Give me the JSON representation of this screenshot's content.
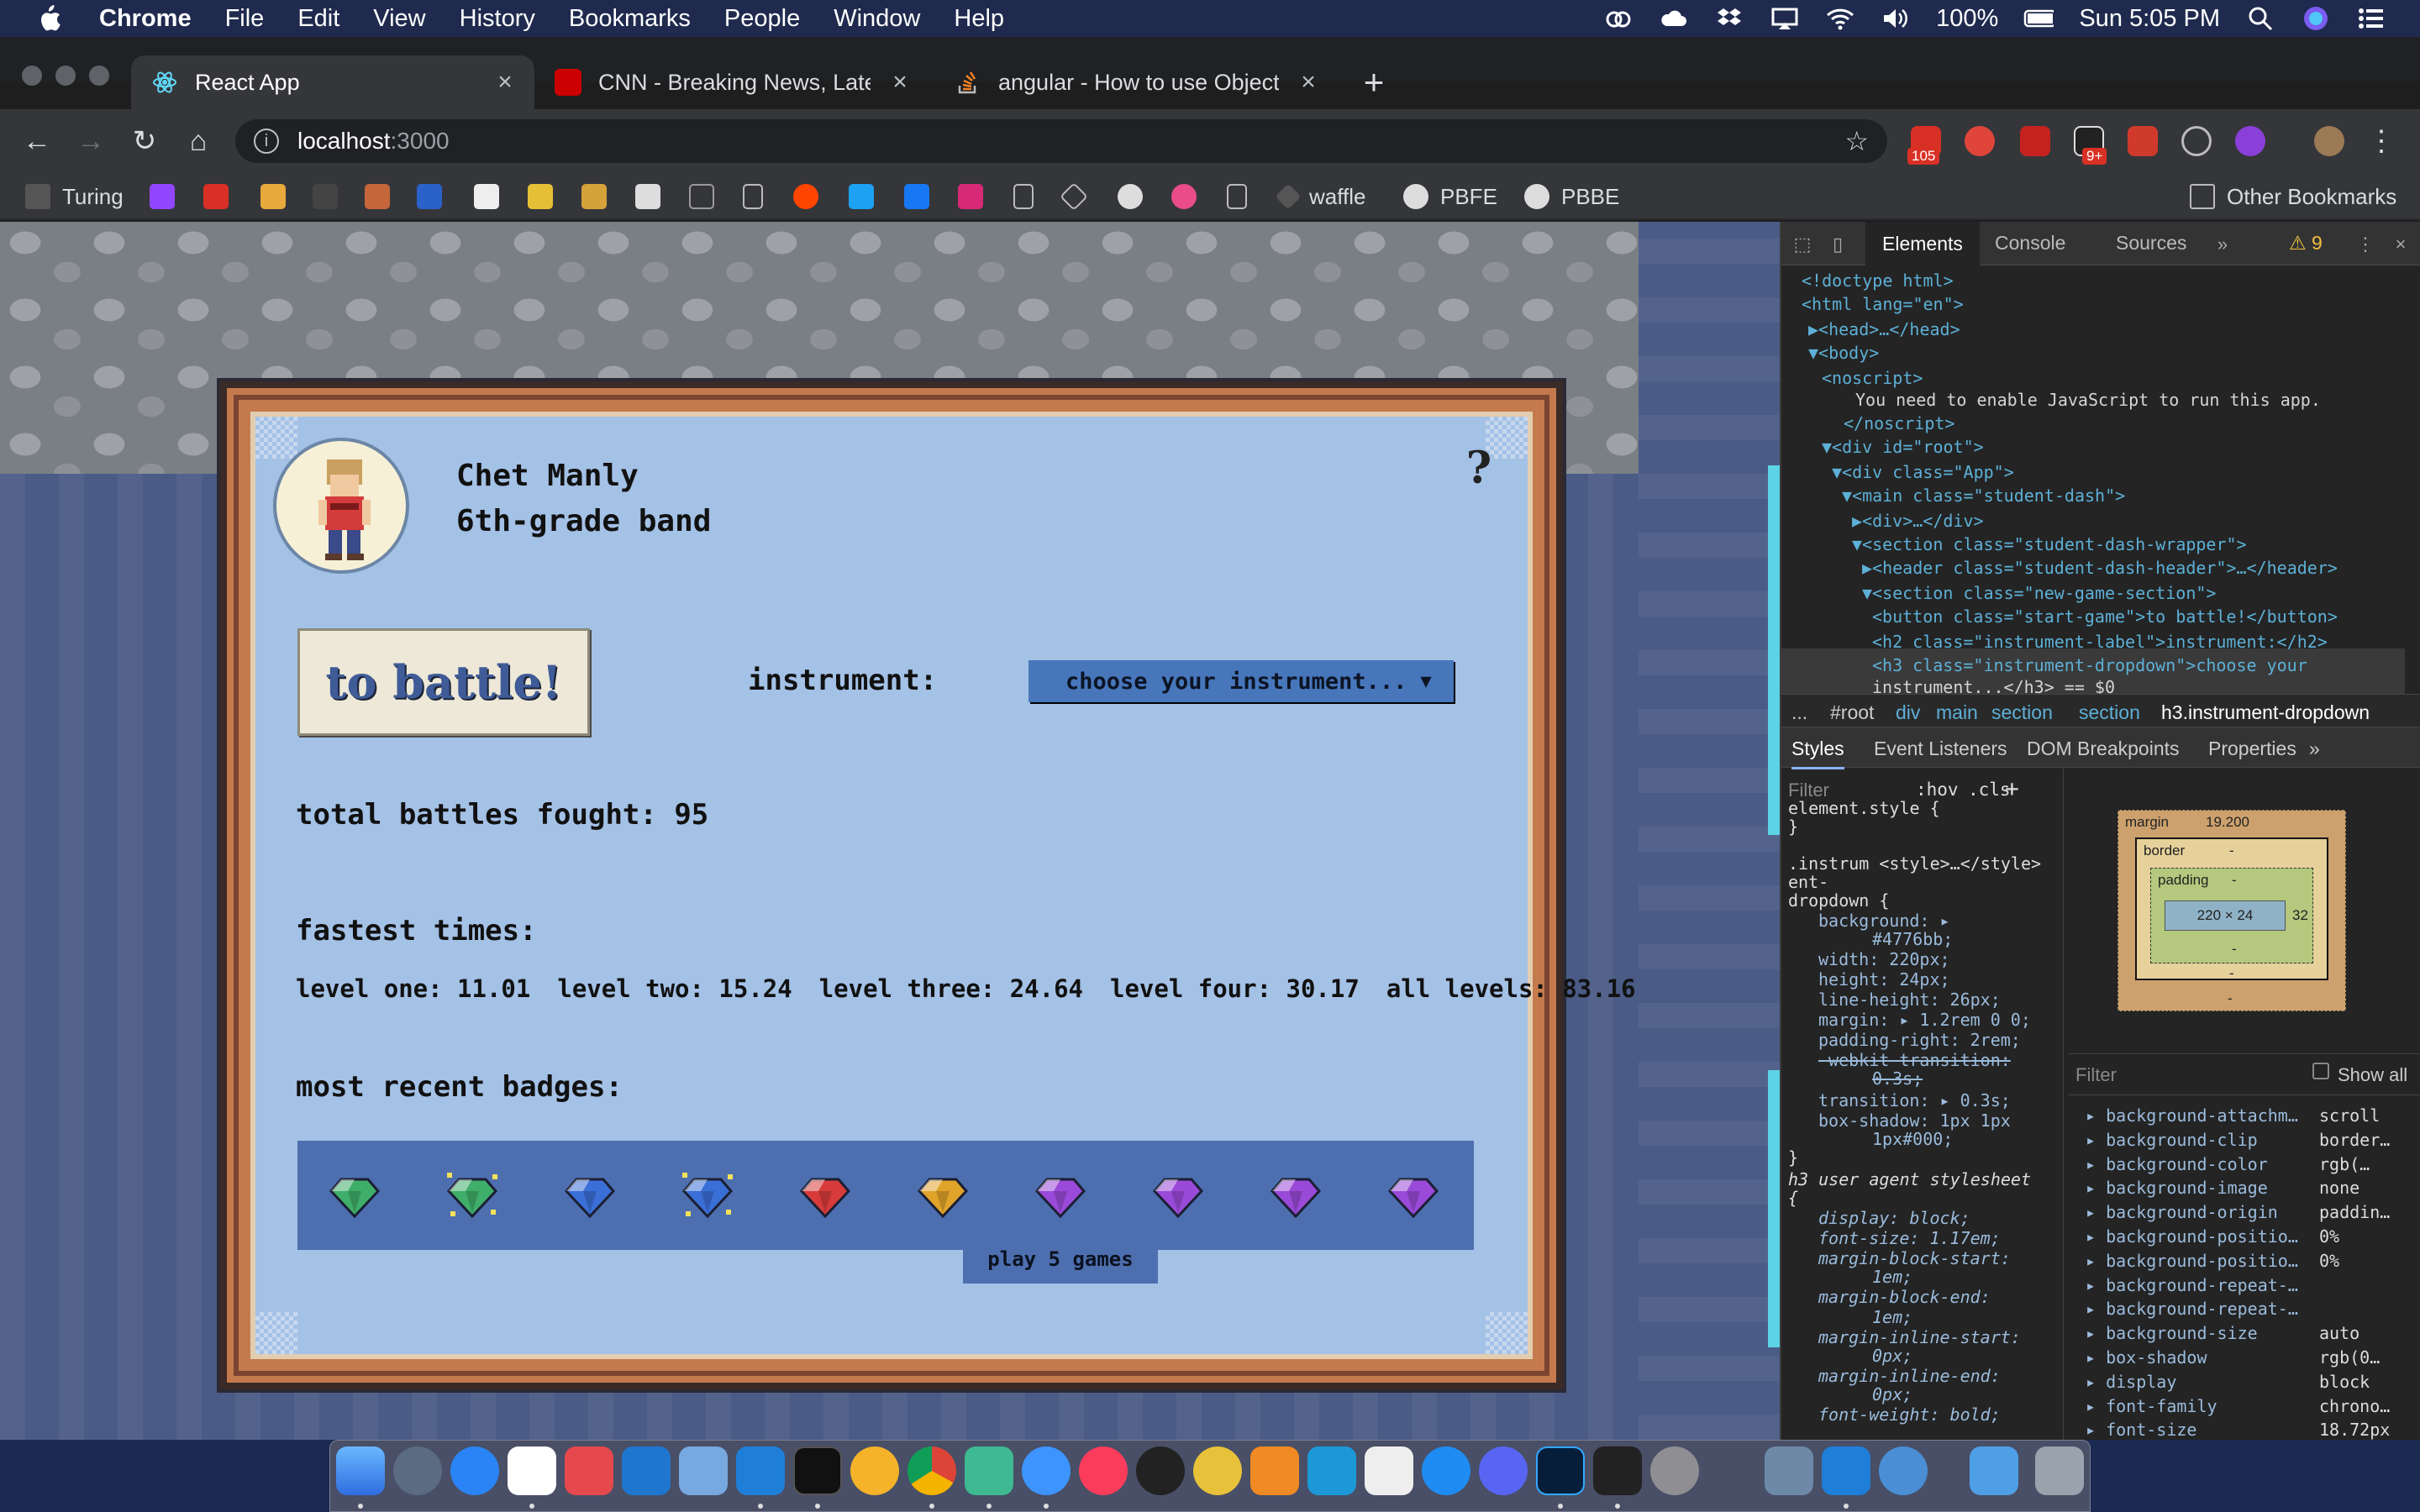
{
  "menubar": {
    "app": "Chrome",
    "items": [
      "File",
      "Edit",
      "View",
      "History",
      "Bookmarks",
      "People",
      "Window",
      "Help"
    ],
    "battery": "100%",
    "clock": "Sun 5:05 PM"
  },
  "browser": {
    "tabs": [
      {
        "title": "React App"
      },
      {
        "title": "CNN - Breaking News, Latest N"
      },
      {
        "title": "angular - How to use Object.va"
      }
    ],
    "url_host": "localhost",
    "url_port": ":3000",
    "ext_badges": [
      "105",
      "9+"
    ],
    "bookmarks": [
      "Turing",
      "waffle",
      "PBFE",
      "PBBE"
    ],
    "other_bookmarks": "Other Bookmarks"
  },
  "game": {
    "student_name": "Chet Manly",
    "student_class": "6th-grade band",
    "help_glyph": "?",
    "start_button": "to battle!",
    "instrument_label": "instrument:",
    "instrument_dropdown": "choose your instrument...",
    "total_battles": "total battles fought: 95",
    "fastest_heading": "fastest times:",
    "times": [
      "level one: 11.01",
      "level two: 15.24",
      "level three: 24.64",
      "level four: 30.17",
      "all levels: 83.16"
    ],
    "badges_heading": "most recent badges:",
    "badges": [
      {
        "color": "#3fae6a",
        "sparkle": false
      },
      {
        "color": "#3fae6a",
        "sparkle": true
      },
      {
        "color": "#3b6fd8",
        "sparkle": false
      },
      {
        "color": "#3b6fd8",
        "sparkle": true
      },
      {
        "color": "#d83b3b",
        "sparkle": false
      },
      {
        "color": "#e0a42a",
        "sparkle": false
      },
      {
        "color": "#9a4ad8",
        "sparkle": false
      },
      {
        "color": "#9a4ad8",
        "sparkle": false
      },
      {
        "color": "#9a4ad8",
        "sparkle": false
      },
      {
        "color": "#9a4ad8",
        "sparkle": false
      }
    ],
    "badge_tooltip": "play 5 games"
  },
  "devtools": {
    "tabs": [
      "Elements",
      "Console",
      "Sources"
    ],
    "warnings": "⚠ 9",
    "dom_lines": [
      "<!doctype html>",
      "<html lang=\"en\">",
      "▶<head>…</head>",
      "▼<body>",
      "<noscript>",
      "You need to enable JavaScript to run this app.",
      "</noscript>",
      "▼<div id=\"root\">",
      "▼<div class=\"App\">",
      "▼<main class=\"student-dash\">",
      "▶<div>…</div>",
      "▼<section class=\"student-dash-wrapper\">",
      "▶<header class=\"student-dash-header\">…</header>",
      "▼<section class=\"new-game-section\">",
      "<button class=\"start-game\">to battle!</button>",
      "<h2 class=\"instrument-label\">instrument:</h2>",
      "<h3 class=\"instrument-dropdown\">choose your",
      "instrument...</h3> == $0"
    ],
    "breadcrumbs": [
      "...",
      "#root",
      "div",
      "main",
      "section",
      "section",
      "h3.instrument-dropdown"
    ],
    "subtabs": [
      "Styles",
      "Event Listeners",
      "DOM Breakpoints",
      "Properties"
    ],
    "filter_placeholder": "Filter",
    "hov": ":hov",
    "cls": ".cls",
    "style_lines": [
      "element.style {",
      "}",
      ".instrum <style>…</style>",
      "ent-",
      "dropdown {",
      "background: ▸",
      "#4776bb;",
      "width: 220px;",
      "height: 24px;",
      "line-height: 26px;",
      "margin: ▸ 1.2rem 0 0;",
      "padding-right: 2rem;",
      "-webkit-transition:",
      "0.3s;",
      "transition: ▸ 0.3s;",
      "box-shadow: 1px 1px",
      "1px#000;",
      "}",
      "h3  user agent stylesheet",
      "{",
      "display: block;",
      "font-size: 1.17em;",
      "margin-block-start:",
      "1em;",
      "margin-block-end:",
      "1em;",
      "margin-inline-start:",
      "0px;",
      "margin-inline-end:",
      "0px;",
      "font-weight: bold;"
    ],
    "box_model": {
      "margin_label": "margin",
      "margin_top": "19.200",
      "border_label": "border",
      "padding_label": "padding",
      "content": "220 × 24",
      "padding_right": "32",
      "dash": "-"
    },
    "computed_filter": "Filter",
    "show_all": "Show all",
    "computed": [
      [
        "background-attachm…",
        "scroll"
      ],
      [
        "background-clip",
        "border…"
      ],
      [
        "background-color",
        "rgb(…"
      ],
      [
        "background-image",
        "none"
      ],
      [
        "background-origin",
        "paddin…"
      ],
      [
        "background-positio…",
        "0%"
      ],
      [
        "background-positio…",
        "0%"
      ],
      [
        "background-repeat-…",
        ""
      ],
      [
        "background-repeat-…",
        ""
      ],
      [
        "background-size",
        "auto"
      ],
      [
        "box-shadow",
        "rgb(0…"
      ],
      [
        "display",
        "block"
      ],
      [
        "font-family",
        "chrono…"
      ],
      [
        "font-size",
        "18.72px"
      ]
    ]
  },
  "colors": {
    "panel_bg": "#a4c1e6",
    "dropdown_bg": "#4776bb",
    "badge_bar": "#4d6fb0"
  }
}
